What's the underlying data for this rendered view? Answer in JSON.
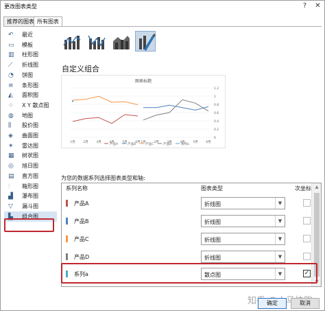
{
  "window": {
    "title": "更改图表类型",
    "help_glyph": "?",
    "close_glyph": "✕"
  },
  "tabs": [
    "推荐的图表",
    "所有图表"
  ],
  "sidebar": {
    "items": [
      {
        "label": "最近",
        "icon": "recent-icon"
      },
      {
        "label": "模板",
        "icon": "template-icon"
      },
      {
        "label": "柱形图",
        "icon": "column-chart-icon"
      },
      {
        "label": "折线图",
        "icon": "line-chart-icon"
      },
      {
        "label": "饼图",
        "icon": "pie-chart-icon"
      },
      {
        "label": "条形图",
        "icon": "bar-chart-icon"
      },
      {
        "label": "面积图",
        "icon": "area-chart-icon"
      },
      {
        "label": "X Y 散点图",
        "icon": "scatter-chart-icon"
      },
      {
        "label": "地图",
        "icon": "map-chart-icon"
      },
      {
        "label": "股价图",
        "icon": "stock-chart-icon"
      },
      {
        "label": "曲面图",
        "icon": "surface-chart-icon"
      },
      {
        "label": "雷达图",
        "icon": "radar-chart-icon"
      },
      {
        "label": "树状图",
        "icon": "treemap-chart-icon"
      },
      {
        "label": "旭日图",
        "icon": "sunburst-chart-icon"
      },
      {
        "label": "直方图",
        "icon": "histogram-chart-icon"
      },
      {
        "label": "箱形图",
        "icon": "box-whisker-chart-icon"
      },
      {
        "label": "瀑布图",
        "icon": "waterfall-chart-icon"
      },
      {
        "label": "漏斗图",
        "icon": "funnel-chart-icon"
      },
      {
        "label": "组合图",
        "icon": "combo-chart-icon",
        "selected": true
      }
    ]
  },
  "main": {
    "subtype_icons": [
      "combo-clustered-column-line-icon",
      "combo-column-line-secondary-axis-icon",
      "combo-stacked-area-column-icon",
      "custom-combo-icon"
    ],
    "subtype_title": "自定义组合",
    "picker_label": "为您的数据系列选择图表类型和轴:",
    "table_headers": {
      "series_name": "系列名称",
      "chart_type": "图表类型",
      "secondary_axis": "次坐标轴"
    },
    "series": [
      {
        "name": "产品A",
        "color": "#c0504d",
        "chart_type": "折线图",
        "secondary": false
      },
      {
        "name": "产品B",
        "color": "#4f81bd",
        "chart_type": "折线图",
        "secondary": false
      },
      {
        "name": "产品C",
        "color": "#f79646",
        "chart_type": "折线图",
        "secondary": false
      },
      {
        "name": "产品D",
        "color": "#7f7f7f",
        "chart_type": "折线图",
        "secondary": false
      },
      {
        "name": "系列a",
        "color": "#4bacc6",
        "chart_type": "散点图",
        "secondary": true
      }
    ]
  },
  "footer": {
    "ok_label": "确定",
    "cancel_label": "取消"
  },
  "watermark": "知乎 @小马快跑",
  "chart_data": {
    "type": "line",
    "title": "图表标题",
    "categories": [
      "1月",
      "2月",
      "3月",
      "4月",
      "5月",
      "6月"
    ],
    "y2_ticks": [
      "1.2",
      "1",
      "0.8",
      "0.6",
      "0.4",
      "0.2",
      "0"
    ],
    "series": [
      {
        "name": "产品A",
        "values_note": "primary axis",
        "values": [
          3.2,
          3.8,
          4.0,
          2.8,
          4.6,
          4.3
        ]
      },
      {
        "name": "产品B",
        "values": [
          6.0,
          6.0,
          6.5,
          6.0,
          5.5,
          6.2
        ]
      },
      {
        "name": "产品C",
        "values": [
          7.5,
          7.7,
          8.3,
          7.1,
          7.2,
          6.6
        ]
      },
      {
        "name": "产品D",
        "values": [
          3.5,
          4.5,
          5.0,
          7.6,
          6.9,
          5.3
        ]
      },
      {
        "name": "系列a",
        "values": [
          7.3,
          7.3,
          7.3,
          7.3,
          7.3,
          7.3
        ]
      }
    ],
    "legend_labels": [
      "产品A",
      "产品B",
      "产品C",
      "产品D",
      "系列a"
    ],
    "legend_position": "bottom"
  }
}
